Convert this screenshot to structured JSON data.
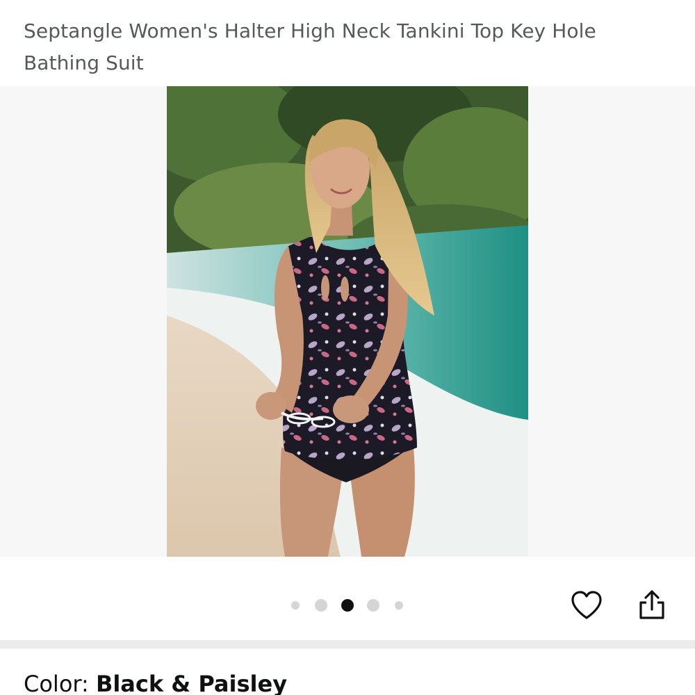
{
  "product": {
    "title": "Septangle Women's Halter High Neck Tankini Top Key Hole Bathing Suit"
  },
  "gallery": {
    "image_count": 5,
    "active_index": 2
  },
  "actions": {
    "wishlist_icon": "heart-icon",
    "share_icon": "share-icon"
  },
  "variation": {
    "color_label": "Color: ",
    "color_value": "Black & Paisley"
  }
}
